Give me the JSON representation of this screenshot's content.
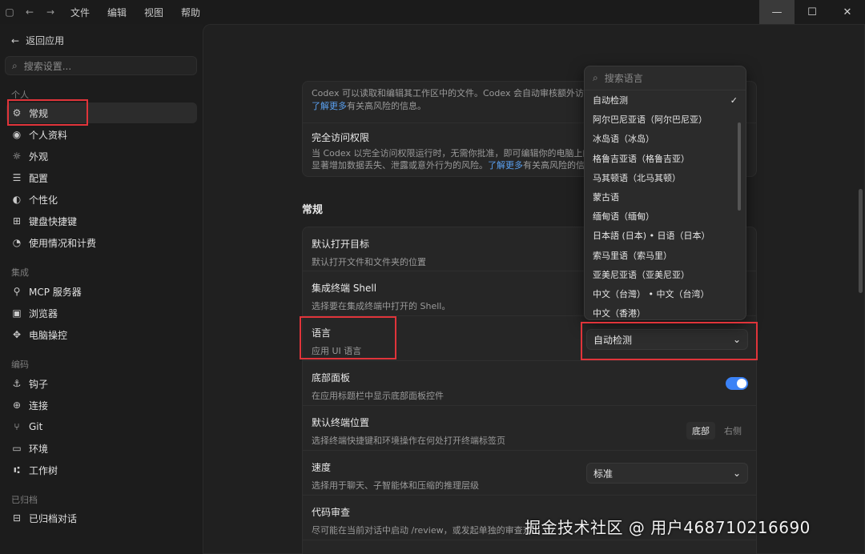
{
  "titlebar": {
    "menu": [
      "文件",
      "编辑",
      "视图",
      "帮助"
    ]
  },
  "sidebar": {
    "back_label": "返回应用",
    "search_placeholder": "搜索设置...",
    "sections": [
      {
        "label": "个人",
        "items": [
          {
            "label": "常规",
            "icon": "gear-icon"
          },
          {
            "label": "个人资料",
            "icon": "person-icon"
          },
          {
            "label": "外观",
            "icon": "sun-icon"
          },
          {
            "label": "配置",
            "icon": "sliders-icon"
          },
          {
            "label": "个性化",
            "icon": "palette-icon"
          },
          {
            "label": "键盘快捷键",
            "icon": "keyboard-icon"
          },
          {
            "label": "使用情况和计费",
            "icon": "gauge-icon"
          }
        ]
      },
      {
        "label": "集成",
        "items": [
          {
            "label": "MCP 服务器",
            "icon": "plug-icon"
          },
          {
            "label": "浏览器",
            "icon": "browser-icon"
          },
          {
            "label": "电脑操控",
            "icon": "cursor-icon"
          }
        ]
      },
      {
        "label": "编码",
        "items": [
          {
            "label": "钩子",
            "icon": "anchor-icon"
          },
          {
            "label": "连接",
            "icon": "globe-icon"
          },
          {
            "label": "Git",
            "icon": "git-icon"
          },
          {
            "label": "环境",
            "icon": "terminal-icon"
          },
          {
            "label": "工作树",
            "icon": "tree-icon"
          }
        ]
      },
      {
        "label": "已归档",
        "items": [
          {
            "label": "已归档对话",
            "icon": "archive-icon"
          }
        ]
      }
    ]
  },
  "main": {
    "top_card": {
      "row1_desc_a": "Codex 可以读取和编辑其工作区中的文件。Codex 会自动审核额外访问",
      "row1_link": "了解更多",
      "row1_desc_b": "有关高风险的信息。",
      "row2_title": "完全访问权限",
      "row2_desc_a": "当 Codex 以完全访问权限运行时，无需你批准，即可编辑你的电脑上的",
      "row2_desc_b": "显著增加数据丢失、泄露或意外行为的风险。",
      "row2_link": "了解更多",
      "row2_desc_c": "有关高风险的信"
    },
    "section_title": "常规",
    "settings": [
      {
        "title": "默认打开目标",
        "desc": "默认打开文件和文件夹的位置"
      },
      {
        "title": "集成终端 Shell",
        "desc": "选择要在集成终端中打开的 Shell。"
      },
      {
        "title": "语言",
        "desc": "应用 UI 语言",
        "value": "自动检测"
      },
      {
        "title": "底部面板",
        "desc": "在应用标题栏中显示底部面板控件"
      },
      {
        "title": "默认终端位置",
        "desc": "选择终端快捷键和环境操作在何处打开终端标签页",
        "options": [
          "底部",
          "右侧"
        ]
      },
      {
        "title": "速度",
        "desc": "选择用于聊天、子智能体和压缩的推理层级",
        "value": "标准"
      },
      {
        "title": "代码审查",
        "desc": "尽可能在当前对话中启动 /review，或发起单独的审查对"
      }
    ]
  },
  "language_dropdown": {
    "search_placeholder": "搜索语言",
    "items": [
      "自动检测",
      "阿尔巴尼亚语（阿尔巴尼亚）",
      "冰岛语（冰岛）",
      "格鲁吉亚语（格鲁吉亚）",
      "马其顿语（北马其顿）",
      "蒙古语",
      "缅甸语（缅甸）",
      "日本語 (日本) • 日语（日本）",
      "索马里语（索马里）",
      "亚美尼亚语（亚美尼亚）",
      "中文（台灣） • 中文（台湾）",
      "中文（香港）"
    ],
    "checked": "✓"
  },
  "watermark": "掘金技术社区 @ 用户4687102166​90",
  "colors": {
    "accent": "#3b82f6",
    "highlight": "#e0343a",
    "link": "#5aa0f0"
  }
}
